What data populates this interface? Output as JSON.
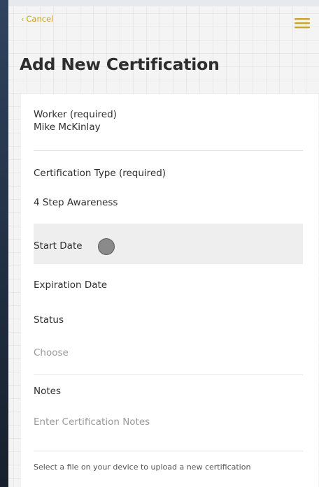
{
  "header": {
    "cancel_label": "Cancel",
    "cancel_icon": "chevron-left-icon",
    "menu_icon": "hamburger-menu-icon",
    "accent_color": "#c9a227"
  },
  "page": {
    "title": "Add New Certification"
  },
  "form": {
    "worker": {
      "label": "Worker (required)",
      "value": "Mike McKinlay"
    },
    "certification_type": {
      "label": "Certification Type (required)",
      "value": "4 Step Awareness"
    },
    "start_date": {
      "label": "Start Date"
    },
    "expiration_date": {
      "label": "Expiration Date"
    },
    "status": {
      "label": "Status",
      "placeholder": "Choose"
    },
    "notes": {
      "label": "Notes",
      "placeholder": "Enter Certification Notes"
    },
    "upload_hint": "Select a file on your device to upload a new certification"
  }
}
